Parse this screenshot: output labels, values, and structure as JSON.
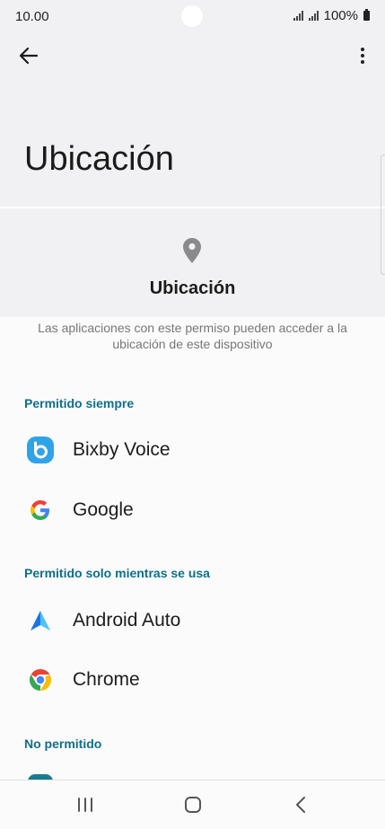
{
  "status_bar": {
    "time": "10.00",
    "battery": "100%"
  },
  "header": {
    "title": "Ubicación"
  },
  "permission": {
    "title": "Ubicación",
    "description": "Las aplicaciones con este permiso pueden acceder a la ubicación de este dispositivo"
  },
  "sections": [
    {
      "label": "Permitido siempre",
      "apps": [
        "Bixby Voice",
        "Google"
      ]
    },
    {
      "label": "Permitido solo mientras se usa",
      "apps": [
        "Android Auto",
        "Chrome"
      ]
    },
    {
      "label": "No permitido",
      "apps": []
    }
  ],
  "icons": {
    "back": "arrow-left-icon",
    "more": "more-vert-icon",
    "permission": "location-pin-icon",
    "nav": [
      "recents-icon",
      "home-icon",
      "back-nav-icon"
    ]
  },
  "colors": {
    "accent": "#0f6f8a",
    "header_bg": "#f1f1f3"
  }
}
